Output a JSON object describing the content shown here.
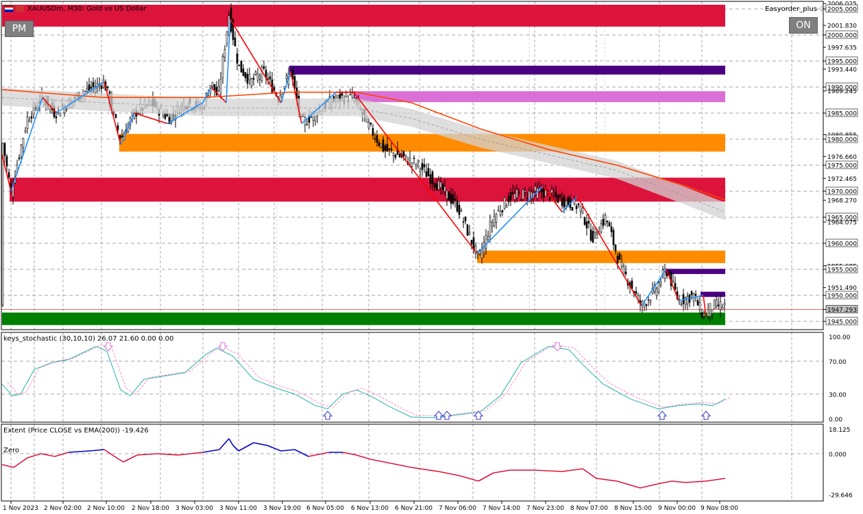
{
  "header": {
    "symbol_title": "XAUUSDm, M30: Gold vs US Dollar",
    "ea_name": "Easyorder_plus"
  },
  "buttons": {
    "pm_label": "PM",
    "on_label": "ON"
  },
  "main_panel": {
    "price_ticks": [
      "2006.025",
      "2005.000",
      "2001.830",
      "2000.000",
      "1997.635",
      "1995.000",
      "1993.440",
      "1990.000",
      "1989.245",
      "1985.000",
      "1980.855",
      "1980.000",
      "1976.660",
      "1975.000",
      "1972.465",
      "1970.000",
      "1968.270",
      "1965.000",
      "1964.075",
      "1960.000",
      "1955.685",
      "1955.000",
      "1951.490",
      "1950.000",
      "1947.293",
      "1945.000"
    ],
    "highlighted_ticks": [
      "2005.000",
      "2000.000",
      "1995.000",
      "1990.000",
      "1985.000",
      "1980.000",
      "1975.000",
      "1970.000",
      "1965.000",
      "1960.000",
      "1955.000",
      "1950.000",
      "1945.000"
    ],
    "current_price": "1947.293"
  },
  "stoch_panel": {
    "title": "keys_stochastic (30,10,10) 26.07 21.60 0.00 0.00",
    "ticks": [
      "100.00",
      "70.00",
      "30.00",
      "0.00"
    ]
  },
  "extent_panel": {
    "title": "Extent (Price CLOSE vs EMA(200)) -19.426",
    "zero_label": "Zero",
    "ticks": [
      "18.125",
      "0.000",
      "-29.646"
    ]
  },
  "time_axis": [
    "1 Nov 2023",
    "2 Nov 02:00",
    "2 Nov 10:00",
    "2 Nov 18:00",
    "3 Nov 03:00",
    "3 Nov 11:00",
    "3 Nov 19:00",
    "6 Nov 05:00",
    "6 Nov 13:00",
    "6 Nov 21:00",
    "7 Nov 06:00",
    "7 Nov 14:00",
    "7 Nov 23:00",
    "8 Nov 07:00",
    "8 Nov 15:00",
    "9 Nov 00:00",
    "9 Nov 08:00"
  ],
  "colors": {
    "bull_zone": "#dc143c",
    "orange_zone": "#ff8c00",
    "purple_zone": "#4b0082",
    "violet_zone": "#da70d6",
    "green_zone": "#008000",
    "zigzag_down": "#ff0000",
    "zigzag_up": "#1e90ff",
    "ema": "#ff4500",
    "stoch_main": "#20b2aa",
    "stoch_signal": "#ff69b4",
    "extent_neg": "#dc143c",
    "extent_pos": "#0000cd"
  }
}
